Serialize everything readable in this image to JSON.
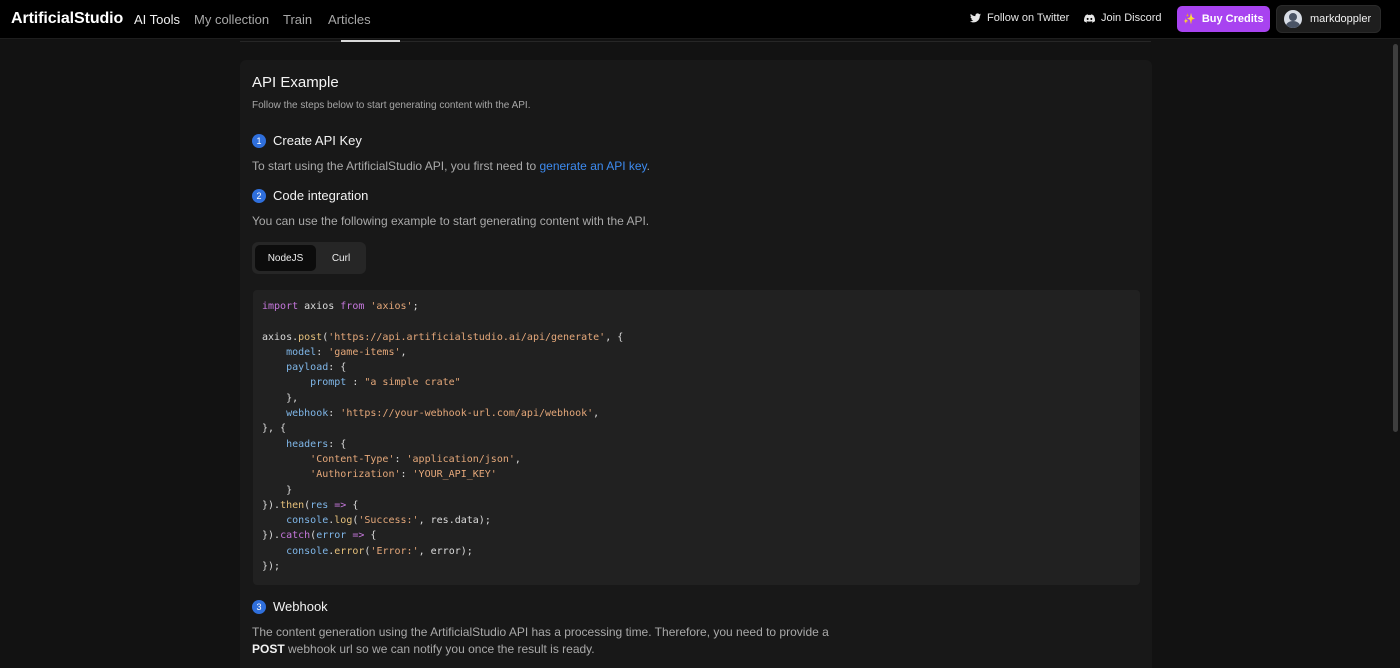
{
  "nav": {
    "brand": "ArtificialStudio",
    "links": [
      "AI Tools",
      "My collection",
      "Train",
      "Articles"
    ],
    "twitter": "Follow on Twitter",
    "discord": "Join Discord",
    "buy": "Buy Credits",
    "user": "markdoppler"
  },
  "section": {
    "title": "API Example",
    "subtitle": "Follow the steps below to start generating content with the API."
  },
  "steps": [
    {
      "number": "1",
      "title": "Create API Key",
      "text_before": "To start using the ArtificialStudio API, you first need to ",
      "link": "generate an API key",
      "text_after": "."
    },
    {
      "number": "2",
      "title": "Code integration",
      "text": "You can use the following example to start generating content with the API."
    },
    {
      "number": "3",
      "title": "Webhook",
      "text_line1": "The content generation using the ArtificialStudio API has a processing time. Therefore, you need to provide a",
      "bold": "POST",
      "text_line2": " webhook url so we can notify you once the result is ready."
    }
  ],
  "code_tabs": [
    "NodeJS",
    "Curl"
  ],
  "code_tabs_selected": "NodeJS",
  "code": {
    "line1_kw": "import",
    "line1_mid": " axios ",
    "line1_kw2": "from",
    "line1_str": "'axios'",
    "url": "'https://api.artificialstudio.ai/api/generate'",
    "model": "'game-items'",
    "prompt": "\"a simple crate\"",
    "webhook": "'https://your-webhook-url.com/api/webhook'",
    "content_type_key": "'Content-Type'",
    "content_type_val": "'application/json'",
    "auth_key": "'Authorization'",
    "auth_val": "'YOUR_API_KEY'",
    "success": "'Success:'",
    "error": "'Error:'"
  },
  "colors": {
    "accent": "#a843f0",
    "link": "#3d8bf0",
    "step_badge": "#2f6fdc"
  }
}
